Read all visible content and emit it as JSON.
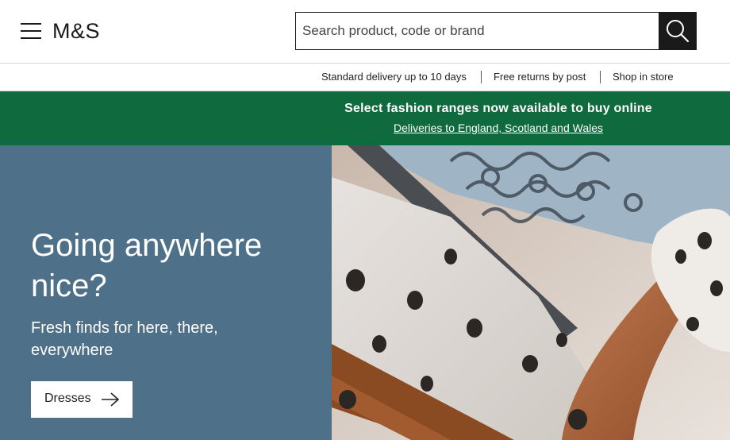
{
  "header": {
    "logo_text": "M&S",
    "search_placeholder": "Search product, code or brand",
    "search_value": ""
  },
  "icons": {
    "menu": "hamburger-icon",
    "search": "search-icon",
    "cta_arrow": "arrow-right-icon"
  },
  "info_bar": {
    "items": [
      "Standard delivery up to 10 days",
      "Free returns by post",
      "Shop in store"
    ]
  },
  "banner": {
    "title": "Select fashion ranges now available to buy online",
    "link": "Deliveries to England, Scotland and Wales",
    "color": "#0f6b3e"
  },
  "hero": {
    "heading": "Going anywhere nice?",
    "subheading": "Fresh finds for here, there, everywhere",
    "cta_label": "Dresses",
    "panel_color": "#4e7088"
  }
}
